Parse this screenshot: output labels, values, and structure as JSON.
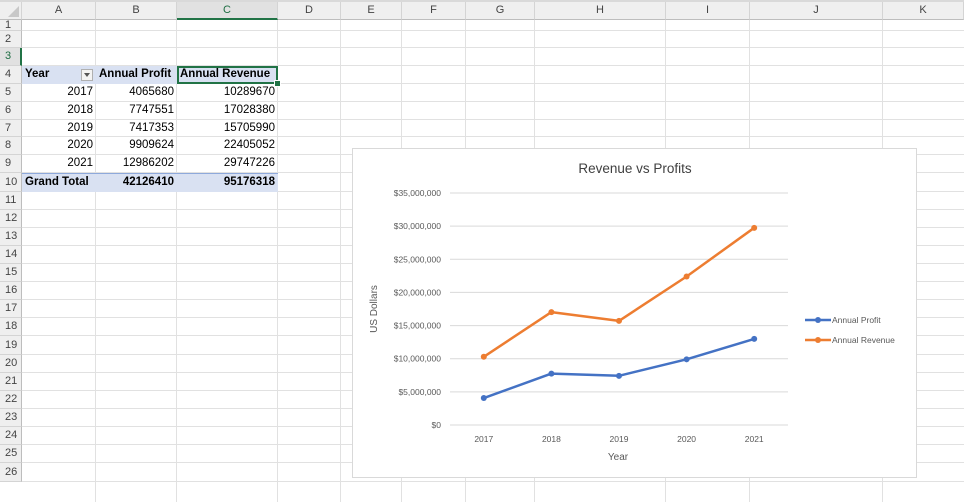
{
  "columns": [
    "A",
    "B",
    "C",
    "D",
    "E",
    "F",
    "G",
    "H",
    "I",
    "J",
    "K"
  ],
  "rows": [
    "1",
    "2",
    "3",
    "4",
    "5",
    "6",
    "7",
    "8",
    "9",
    "10",
    "11",
    "12",
    "13",
    "14",
    "15",
    "16",
    "17",
    "18",
    "19",
    "20",
    "21",
    "22",
    "23",
    "24",
    "25",
    "26"
  ],
  "selected_column": "C",
  "selected_row": "3",
  "pivot": {
    "headers": [
      "Year",
      "Annual Profit",
      "Annual Revenue"
    ],
    "rows": [
      [
        "2017",
        "4065680",
        "10289670"
      ],
      [
        "2018",
        "7747551",
        "17028380"
      ],
      [
        "2019",
        "7417353",
        "15705990"
      ],
      [
        "2020",
        "9909624",
        "22405052"
      ],
      [
        "2021",
        "12986202",
        "29747226"
      ]
    ],
    "total": [
      "Grand Total",
      "42126410",
      "95176318"
    ]
  },
  "chart_data": {
    "type": "line",
    "title": "Revenue vs Profits",
    "xlabel": "Year",
    "ylabel": "US Dollars",
    "categories": [
      "2017",
      "2018",
      "2019",
      "2020",
      "2021"
    ],
    "ylim": [
      0,
      35000000
    ],
    "y_ticks": [
      "$0",
      "$5,000,000",
      "$10,000,000",
      "$15,000,000",
      "$20,000,000",
      "$25,000,000",
      "$30,000,000",
      "$35,000,000"
    ],
    "y_tick_values": [
      0,
      5000000,
      10000000,
      15000000,
      20000000,
      25000000,
      30000000,
      35000000
    ],
    "grid": true,
    "legend_position": "right",
    "series": [
      {
        "name": "Annual Profit",
        "color": "#4472c4",
        "values": [
          4065680,
          7747551,
          7417353,
          9909624,
          12986202
        ]
      },
      {
        "name": "Annual Revenue",
        "color": "#ed7d31",
        "values": [
          10289670,
          17028380,
          15705990,
          22405052,
          29747226
        ]
      }
    ]
  }
}
